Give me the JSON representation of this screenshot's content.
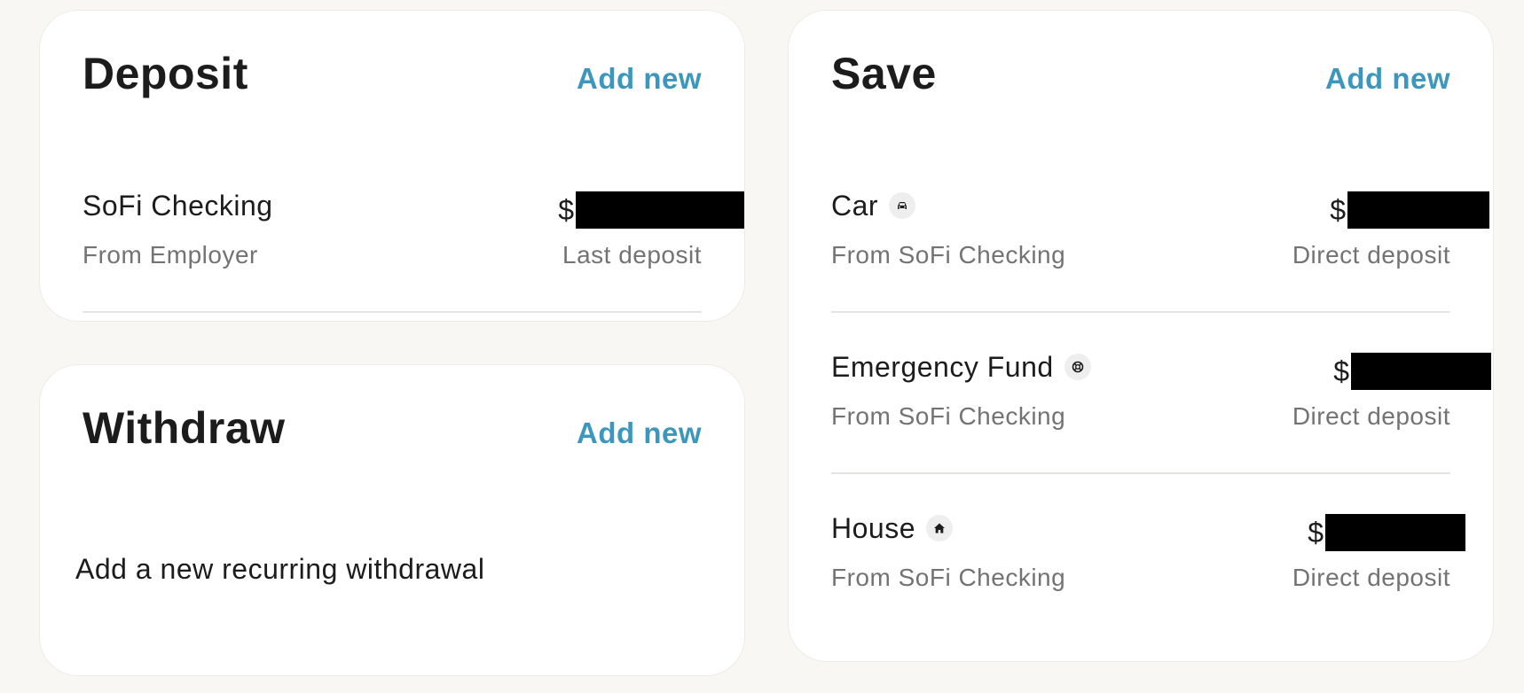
{
  "deposit": {
    "title": "Deposit",
    "add_new": "Add new",
    "items": [
      {
        "name": "SoFi Checking",
        "source": "From Employer",
        "amount_prefix": "$",
        "meta": "Last deposit"
      }
    ]
  },
  "withdraw": {
    "title": "Withdraw",
    "add_new": "Add new",
    "empty_text": "Add a new recurring withdrawal"
  },
  "save": {
    "title": "Save",
    "add_new": "Add new",
    "items": [
      {
        "name": "Car",
        "icon": "car-icon",
        "source": "From SoFi Checking",
        "amount_prefix": "$",
        "meta": "Direct deposit"
      },
      {
        "name": "Emergency Fund",
        "icon": "lifebuoy-icon",
        "source": "From SoFi Checking",
        "amount_prefix": "$",
        "meta": "Direct deposit"
      },
      {
        "name": "House",
        "icon": "house-icon",
        "source": "From SoFi Checking",
        "amount_prefix": "$",
        "meta": "Direct deposit"
      }
    ]
  },
  "colors": {
    "accent": "#3d97bd",
    "background": "#f8f7f4",
    "card": "#ffffff",
    "primary_text": "#1c1c1c",
    "secondary_text": "#737373"
  }
}
